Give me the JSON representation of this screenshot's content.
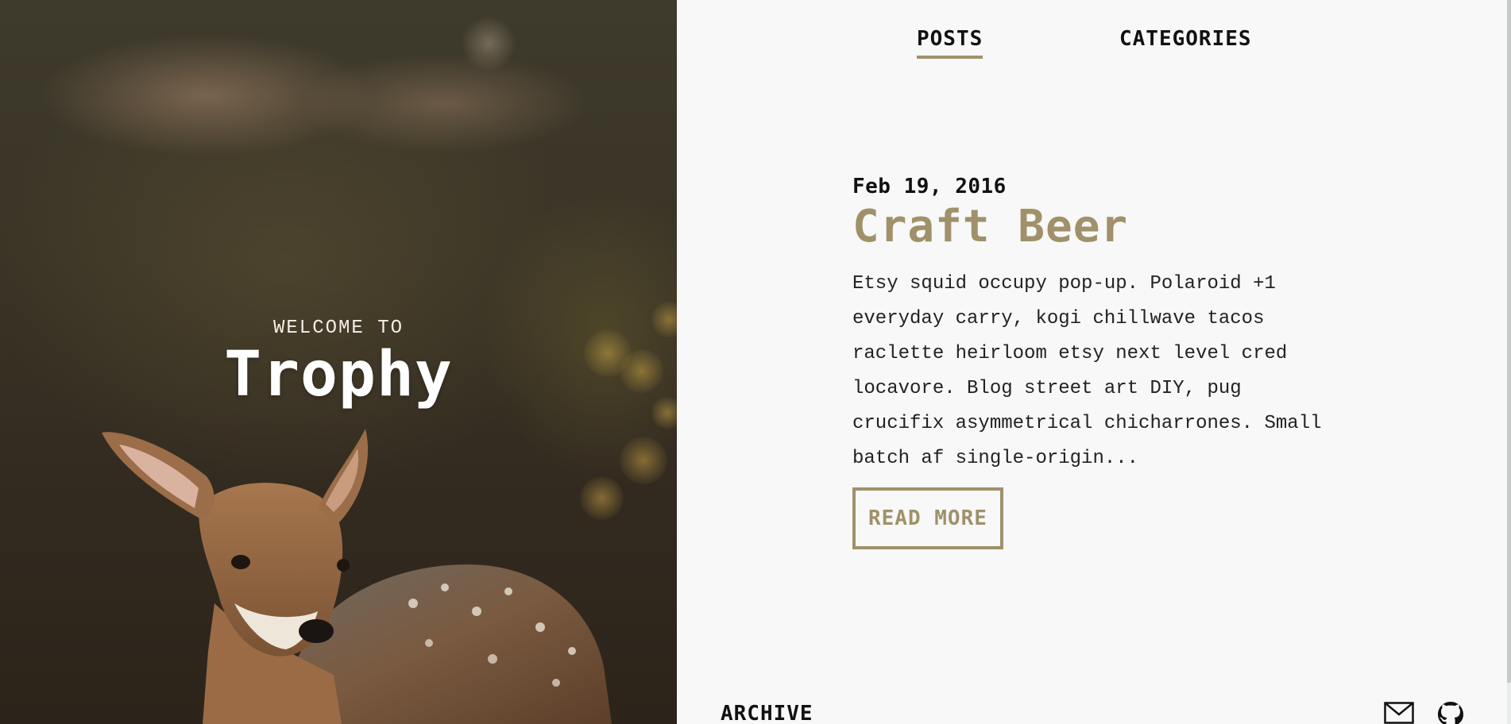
{
  "hero": {
    "welcome": "WELCOME TO",
    "title": "Trophy",
    "image_icon": "deer-photo"
  },
  "nav": {
    "items": [
      {
        "label": "POSTS",
        "active": true
      },
      {
        "label": "CATEGORIES",
        "active": false
      }
    ]
  },
  "post": {
    "date": "Feb 19, 2016",
    "title": "Craft Beer",
    "excerpt": "Etsy squid occupy pop-up. Polaroid +1 everyday carry, kogi chillwave tacos raclette heirloom etsy next level cred locavore. Blog street art DIY, pug crucifix asymmetrical chicharrones. Small batch af single-origin...",
    "read_more_label": "READ MORE"
  },
  "footer": {
    "archive_label": "ARCHIVE",
    "icons": [
      "mail-icon",
      "github-icon"
    ]
  },
  "colors": {
    "accent": "#a0916a",
    "background": "#f7f8f7",
    "text": "#111111"
  }
}
